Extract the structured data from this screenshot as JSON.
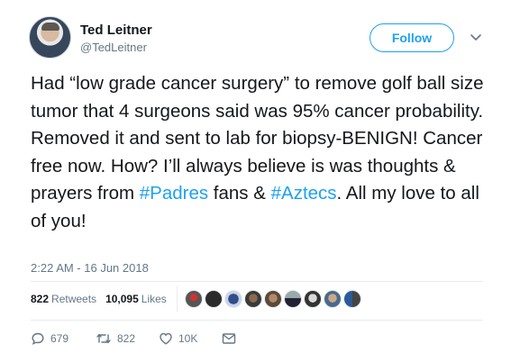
{
  "user": {
    "name": "Ted Leitner",
    "handle": "@TedLeitner",
    "follow_label": "Follow"
  },
  "tweet": {
    "text_before": "Had “low grade cancer surgery” to remove golf ball size tumor that 4 surgeons said was 95% cancer probability. Removed it and sent to lab for biopsy-BENIGN! Cancer free now. How? I’ll always believe is was thoughts & prayers from ",
    "hashtag1": "#Padres",
    "text_middle": " fans & ",
    "hashtag2": "#Aztecs",
    "text_after": ". All my love to all of you!"
  },
  "timestamp": "2:22 AM - 16 Jun 2018",
  "stats": {
    "retweets_count": "822",
    "retweets_label": "Retweets",
    "likes_count": "10,095",
    "likes_label": "Likes"
  },
  "actions": {
    "replies": "679",
    "retweets": "822",
    "likes": "10K"
  },
  "colors": {
    "accent": "#1da1f2",
    "text": "#14171a",
    "muted": "#657786",
    "divider": "#e6ecf0"
  },
  "liker_avatars": [
    "liker-avatar-1",
    "liker-avatar-2",
    "liker-avatar-3",
    "liker-avatar-4",
    "liker-avatar-5",
    "liker-avatar-6",
    "liker-avatar-7",
    "liker-avatar-8",
    "liker-avatar-9"
  ]
}
